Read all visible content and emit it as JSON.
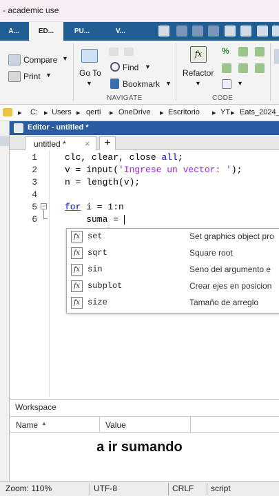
{
  "window": {
    "title": "- academic use"
  },
  "tabs": [
    "A...",
    "ED...",
    "PU...",
    "V..."
  ],
  "ribbon": {
    "compare": "Compare",
    "print": "Print",
    "goto": "Go To",
    "find": "Find",
    "bookmark": "Bookmark",
    "refactor": "Refactor",
    "navigate_label": "NAVIGATE",
    "code_label": "CODE",
    "fx_label": "fx",
    "pct": "%"
  },
  "address": {
    "parts": [
      "C:",
      "Users",
      "qerti",
      "OneDrive",
      "Escritorio",
      "YT",
      "Eats_2024_("
    ]
  },
  "editor": {
    "title": "Editor - untitled *",
    "tab_label": "untitled *",
    "close": "×",
    "plus": "+",
    "line_numbers": [
      "1",
      "2",
      "3",
      "4",
      "5",
      "6"
    ],
    "lines": [
      {
        "a": "clc, clear, close ",
        "b": "all",
        "c": ";"
      },
      {
        "a": "v = input(",
        "b": "'Ingrese un vector: '",
        "c": ");"
      },
      {
        "a": "n = length(v);"
      },
      {
        "a": ""
      },
      {
        "kw": "for",
        "rest": " i = 1:n"
      },
      {
        "a": "    suma = "
      }
    ]
  },
  "autocomplete": {
    "icon": "fx",
    "items": [
      {
        "name": "set",
        "desc": "Set graphics object pro"
      },
      {
        "name": "sqrt",
        "desc": "Square root"
      },
      {
        "name": "sin",
        "desc": "Seno del argumento e"
      },
      {
        "name": "subplot",
        "desc": "Crear ejes en posicion"
      },
      {
        "name": "size",
        "desc": "Tamaño de arreglo"
      }
    ]
  },
  "workspace": {
    "title": "Workspace",
    "col_name": "Name",
    "col_value": "Value"
  },
  "caption": "a ir sumando",
  "status": {
    "zoom": "Zoom: 110%",
    "encoding": "UTF-8",
    "eol": "CRLF",
    "type": "script"
  },
  "colors": {
    "tabstrip": "#1f5d92",
    "editor_header": "#2a5aa0",
    "keyword": "#0000ff",
    "string": "#a020f0"
  }
}
